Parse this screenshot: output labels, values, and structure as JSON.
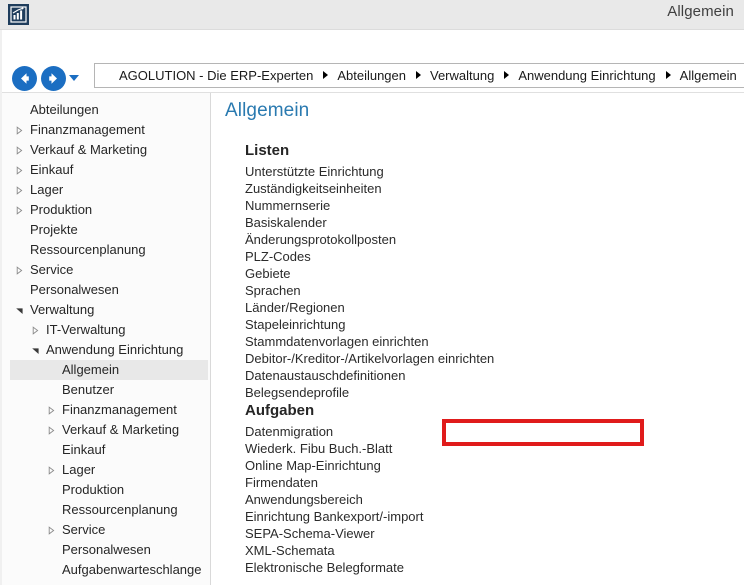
{
  "window": {
    "title": "Allgemein",
    "app_icon": "chart-app-icon"
  },
  "navigation": {
    "back_icon": "arrow-left-icon",
    "forward_icon": "arrow-right-icon",
    "history_dropdown_icon": "chevron-down-icon",
    "ribbon_toggle_icon": "chevron-down-icon",
    "breadcrumb": [
      "AGOLUTION - Die ERP-Experten",
      "Abteilungen",
      "Verwaltung",
      "Anwendung Einrichtung",
      "Allgemein"
    ]
  },
  "sidebar": {
    "items": [
      {
        "label": "Abteilungen",
        "indent": 0,
        "twisty": "none",
        "selected": false
      },
      {
        "label": "Finanzmanagement",
        "indent": 0,
        "twisty": "collapsed",
        "selected": false
      },
      {
        "label": "Verkauf & Marketing",
        "indent": 0,
        "twisty": "collapsed",
        "selected": false
      },
      {
        "label": "Einkauf",
        "indent": 0,
        "twisty": "collapsed",
        "selected": false
      },
      {
        "label": "Lager",
        "indent": 0,
        "twisty": "collapsed",
        "selected": false
      },
      {
        "label": "Produktion",
        "indent": 0,
        "twisty": "collapsed",
        "selected": false
      },
      {
        "label": "Projekte",
        "indent": 0,
        "twisty": "none",
        "selected": false
      },
      {
        "label": "Ressourcenplanung",
        "indent": 0,
        "twisty": "none",
        "selected": false
      },
      {
        "label": "Service",
        "indent": 0,
        "twisty": "collapsed",
        "selected": false
      },
      {
        "label": "Personalwesen",
        "indent": 0,
        "twisty": "none",
        "selected": false
      },
      {
        "label": "Verwaltung",
        "indent": 0,
        "twisty": "expanded",
        "selected": false
      },
      {
        "label": "IT-Verwaltung",
        "indent": 1,
        "twisty": "collapsed",
        "selected": false
      },
      {
        "label": "Anwendung Einrichtung",
        "indent": 1,
        "twisty": "expanded",
        "selected": false
      },
      {
        "label": "Allgemein",
        "indent": 2,
        "twisty": "none",
        "selected": true
      },
      {
        "label": "Benutzer",
        "indent": 2,
        "twisty": "none",
        "selected": false
      },
      {
        "label": "Finanzmanagement",
        "indent": 2,
        "twisty": "collapsed",
        "selected": false
      },
      {
        "label": "Verkauf & Marketing",
        "indent": 2,
        "twisty": "collapsed",
        "selected": false
      },
      {
        "label": "Einkauf",
        "indent": 2,
        "twisty": "none",
        "selected": false
      },
      {
        "label": "Lager",
        "indent": 2,
        "twisty": "collapsed",
        "selected": false
      },
      {
        "label": "Produktion",
        "indent": 2,
        "twisty": "none",
        "selected": false
      },
      {
        "label": "Ressourcenplanung",
        "indent": 2,
        "twisty": "none",
        "selected": false
      },
      {
        "label": "Service",
        "indent": 2,
        "twisty": "collapsed",
        "selected": false
      },
      {
        "label": "Personalwesen",
        "indent": 2,
        "twisty": "none",
        "selected": false
      },
      {
        "label": "Aufgabenwarteschlange",
        "indent": 2,
        "twisty": "none",
        "selected": false
      }
    ]
  },
  "content": {
    "page_title": "Allgemein",
    "sections": [
      {
        "title": "Listen",
        "items": [
          "Unterstützte Einrichtung",
          "Zuständigkeitseinheiten",
          "Nummernserie",
          "Basiskalender",
          "Änderungsprotokollposten",
          "PLZ-Codes",
          "Gebiete",
          "Sprachen",
          "Länder/Regionen",
          "Stapeleinrichtung",
          "Stammdatenvorlagen einrichten",
          "Debitor-/Kreditor-/Artikelvorlagen einrichten",
          "Datenaustauschdefinitionen",
          "Belegsendeprofile"
        ]
      },
      {
        "title": "Aufgaben",
        "items": [
          "Datenmigration",
          "Wiederk. Fibu Buch.-Blatt",
          "Online Map-Einrichtung",
          "Firmendaten",
          "Anwendungsbereich",
          "Einrichtung Bankexport/-import",
          "SEPA-Schema-Viewer",
          "XML-Schemata",
          "Elektronische Belegformate"
        ]
      }
    ],
    "highlight": {
      "target_label": "Stammdatenvorlagen einrichten",
      "color": "#e01b1b"
    }
  },
  "colors": {
    "accent_blue": "#1b6ec2",
    "title_blue": "#2a7ab0",
    "titlebar_bg": "#e9e9e9",
    "sidebar_bg": "#fbfbfb",
    "selection_bg": "#e8e8e8",
    "highlight_red": "#e01b1b"
  }
}
